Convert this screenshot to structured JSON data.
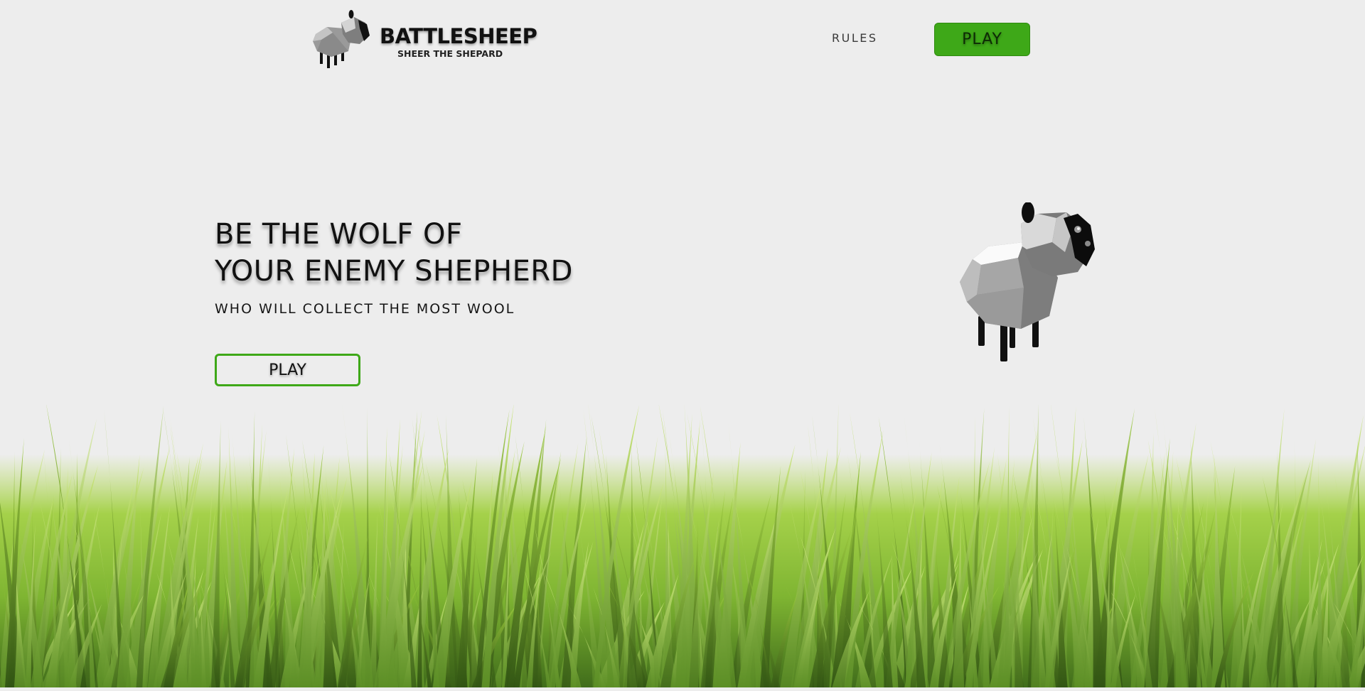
{
  "header": {
    "logo": {
      "title": "BATTLESHEEP",
      "tagline": "SHEER THE SHEPARD"
    },
    "nav": {
      "rules_label": "RULES",
      "play_label": "PLAY"
    }
  },
  "hero": {
    "title_line1": "BE THE WOLF OF",
    "title_line2": "YOUR ENEMY SHEPHERD",
    "subtitle": "WHO WILL COLLECT THE MOST WOOL",
    "play_label": "PLAY"
  },
  "colors": {
    "background": "#ededed",
    "accent_green": "#3ea818",
    "grass_light": "#a8d64a",
    "grass_dark": "#3f6e18"
  },
  "icons": {
    "logo_mark": "sheep-logo-icon",
    "hero_image": "sheep-illustration"
  }
}
